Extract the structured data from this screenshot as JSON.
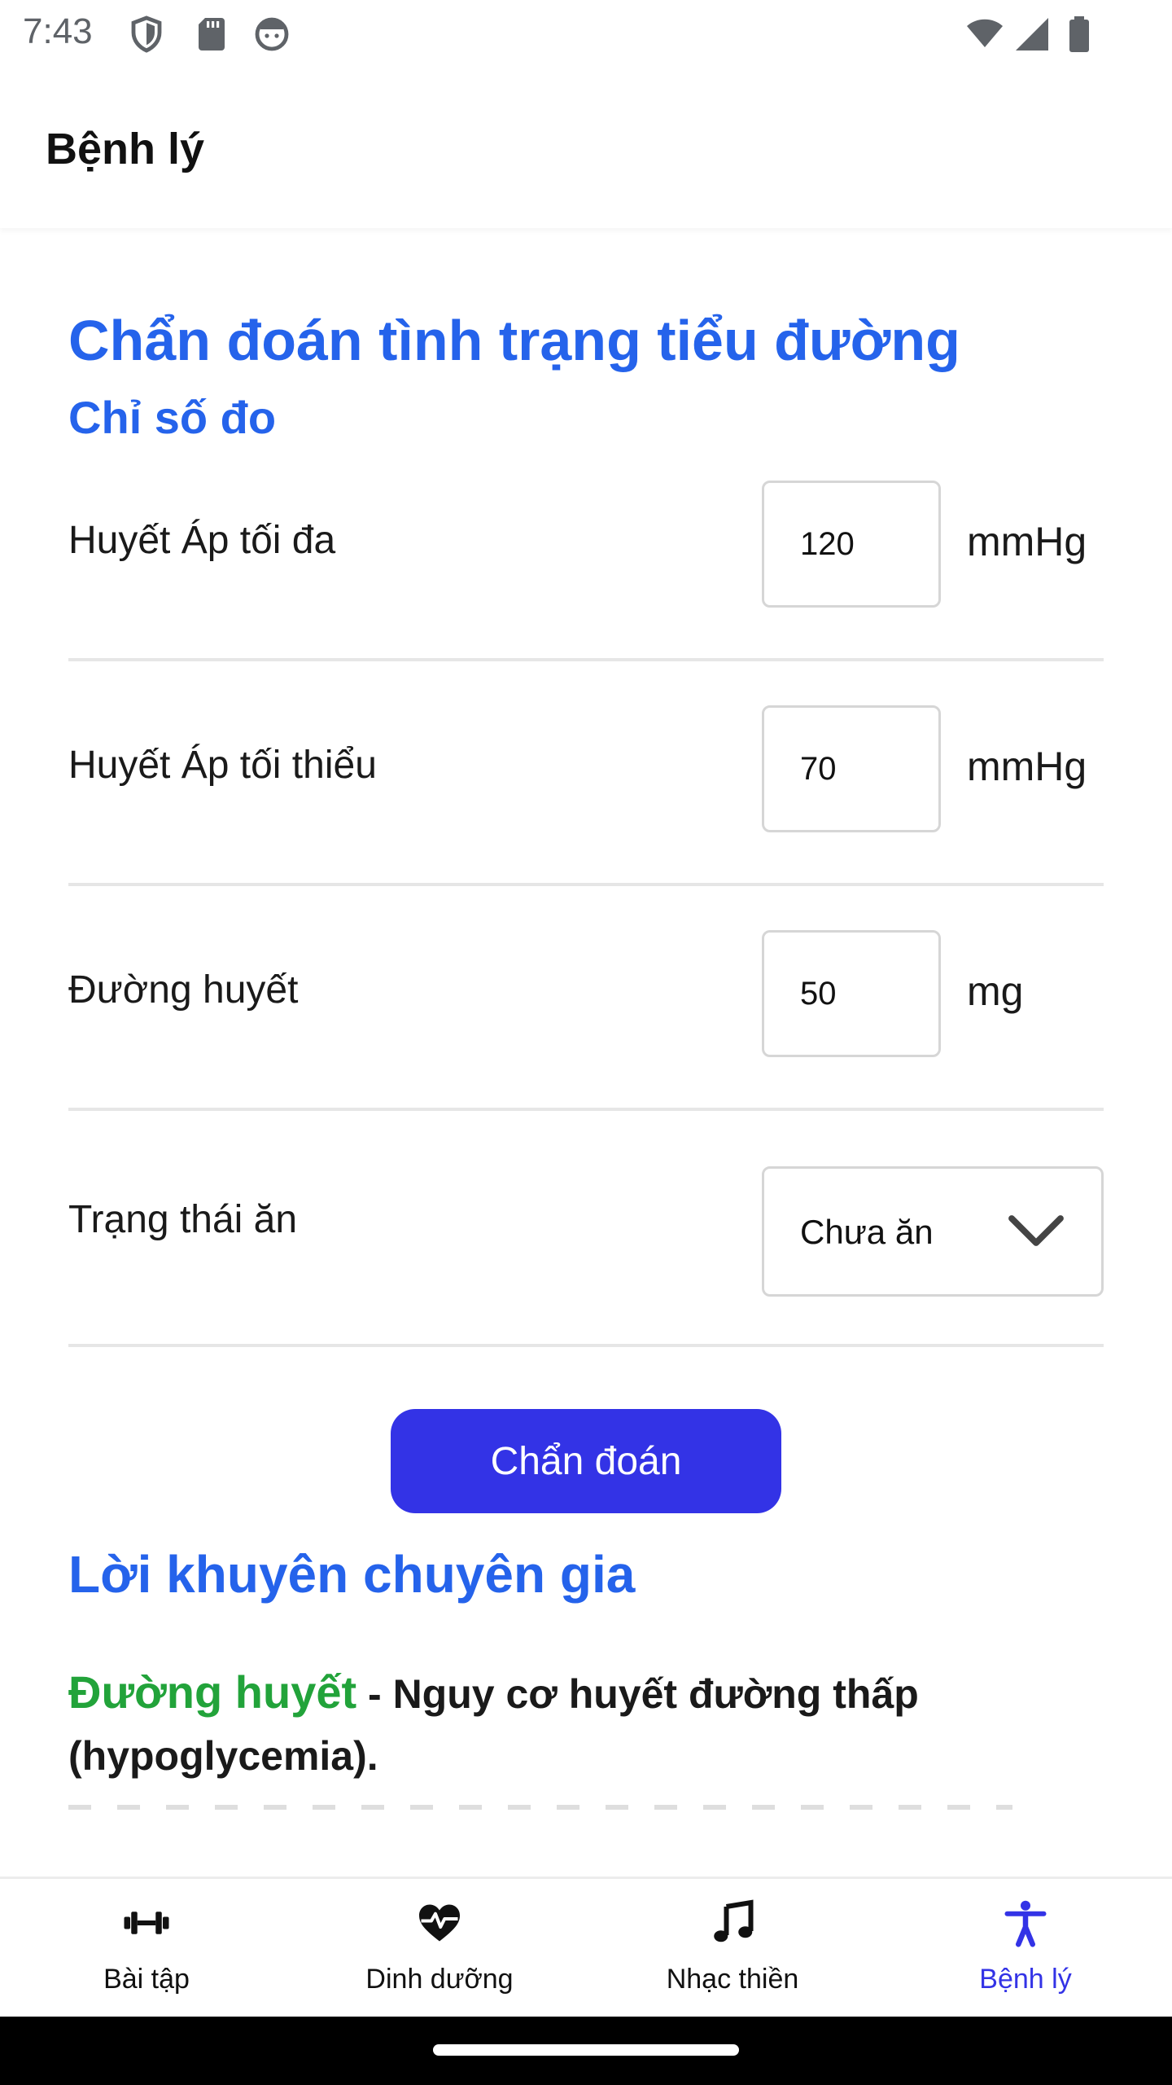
{
  "status_bar": {
    "time": "7:43"
  },
  "app_bar": {
    "title": "Bệnh lý"
  },
  "form": {
    "title": "Chẩn đoán tình trạng tiểu đường",
    "subtitle": "Chỉ số đo",
    "fields": [
      {
        "label": "Huyết Áp tối đa",
        "value": "120",
        "unit": "mmHg"
      },
      {
        "label": "Huyết Áp tối thiểu",
        "value": "70",
        "unit": "mmHg"
      },
      {
        "label": "Đường huyết",
        "value": "50",
        "unit": "mg"
      }
    ],
    "meal_state": {
      "label": "Trạng thái ăn",
      "selected": "Chưa ăn"
    },
    "submit_label": "Chẩn đoán"
  },
  "advice": {
    "title": "Lời khuyên chuyên gia",
    "key": "Đường huyết",
    "text": " - Nguy cơ huyết đường thấp (hypoglycemia)."
  },
  "bottom_nav": {
    "items": [
      {
        "label": "Bài tập",
        "icon": "dumbbell-icon"
      },
      {
        "label": "Dinh dưỡng",
        "icon": "heart-pulse-icon"
      },
      {
        "label": "Nhạc thiền",
        "icon": "music-note-icon"
      },
      {
        "label": "Bệnh lý",
        "icon": "accessibility-icon",
        "active": true
      }
    ]
  },
  "colors": {
    "accent": "#2563eb",
    "button": "#3333e6",
    "advice_key": "#22a33a"
  }
}
